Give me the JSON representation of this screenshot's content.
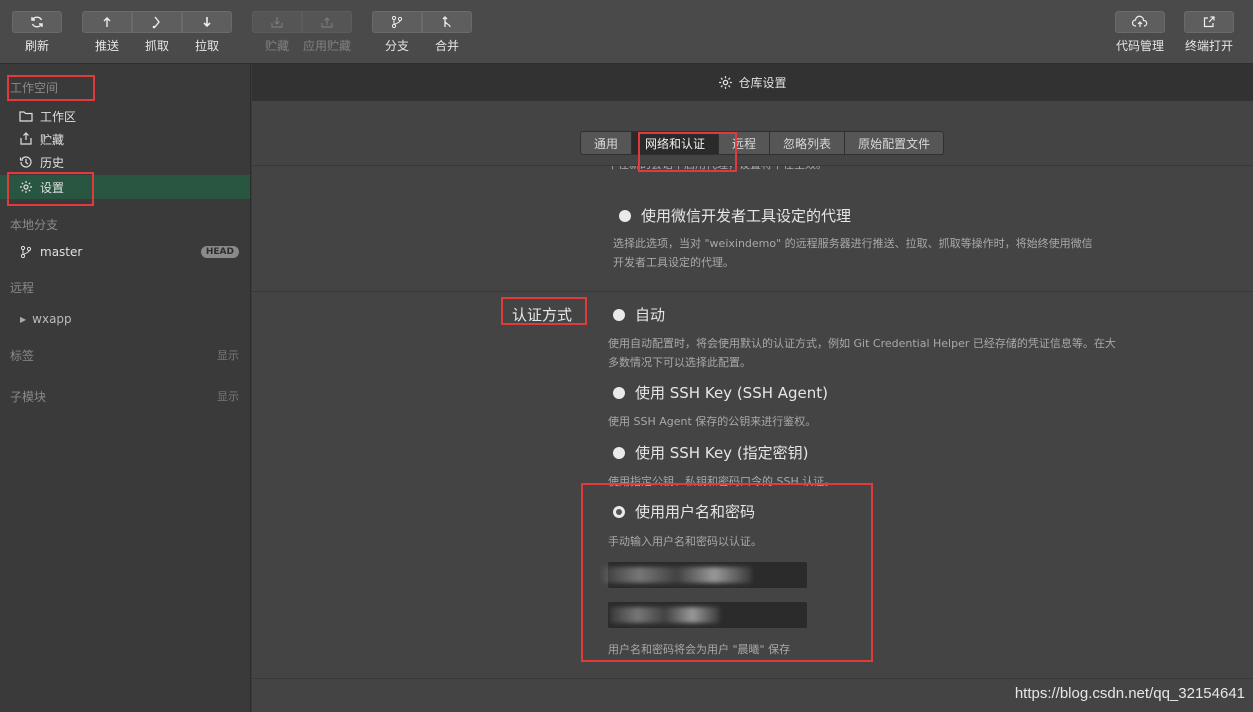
{
  "toolbar": {
    "refresh": "刷新",
    "push": "推送",
    "fetch": "抓取",
    "pull": "拉取",
    "stash": "贮藏",
    "apply_stash": "应用贮藏",
    "branch": "分支",
    "merge": "合并",
    "code_mgmt": "代码管理",
    "open_terminal": "终端打开"
  },
  "sidebar": {
    "workspace_title": "工作空间",
    "workspace_items": [
      "工作区",
      "贮藏",
      "历史",
      "设置"
    ],
    "local_branches_title": "本地分支",
    "branch": "master",
    "branch_badge": "HEAD",
    "remote_title": "远程",
    "remote": "wxapp",
    "tags_title": "标签",
    "tags_show": "显示",
    "submodule_title": "子模块",
    "submodule_show": "显示"
  },
  "header": {
    "title": "仓库设置"
  },
  "tabs": [
    "通用",
    "网络和认证",
    "远程",
    "忽略列表",
    "原始配置文件"
  ],
  "active_tab": "网络和认证",
  "proxy": {
    "cut_text": "不在新的会话中启用代理，设置将不在生效。",
    "option": "使用微信开发者工具设定的代理",
    "desc_line1": "选择此选项，当对 \"weixindemo\" 的远程服务器进行推送、拉取、抓取等操作时，将始终使用微信",
    "desc_line2": "开发者工具设定的代理。"
  },
  "auth": {
    "label": "认证方式",
    "auto": "自动",
    "auto_desc_line1": "使用自动配置时，将会使用默认的认证方式，例如 Git Credential Helper 已经存储的凭证信息等。在大",
    "auto_desc_line2": "多数情况下可以选择此配置。",
    "ssh_agent": "使用 SSH Key (SSH Agent)",
    "ssh_agent_desc": "使用 SSH Agent 保存的公钥来进行鉴权。",
    "ssh_key": "使用 SSH Key (指定密钥)",
    "ssh_key_desc": "使用指定公钥、私钥和密码口令的 SSH 认证。",
    "userpass": "使用用户名和密码",
    "userpass_desc": "手动输入用户名和密码以认证。",
    "userpass_footer": "用户名和密码将会为用户 \"晨曦\" 保存"
  },
  "watermark": "https://blog.csdn.net/qq_32154641",
  "colors": {
    "active_green": "#285641",
    "highlight_red": "#e03a3a"
  }
}
